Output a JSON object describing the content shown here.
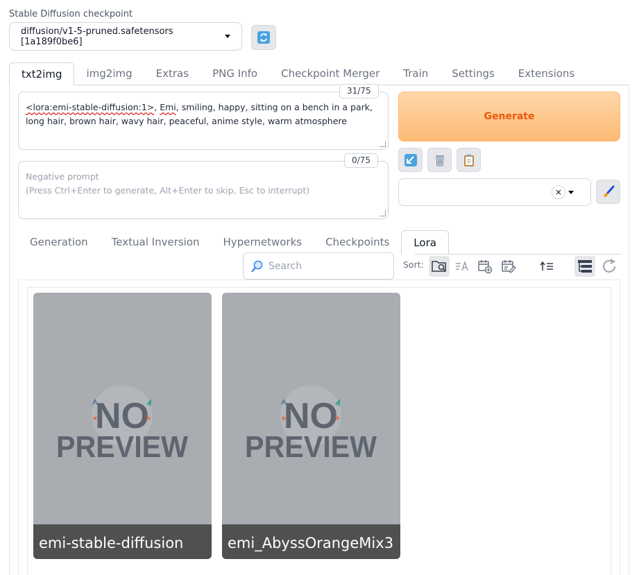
{
  "checkpoint": {
    "label": "Stable Diffusion checkpoint",
    "value": "diffusion/v1-5-pruned.safetensors [1a189f0be6]"
  },
  "main_tabs": [
    {
      "label": "txt2img",
      "active": true
    },
    {
      "label": "img2img"
    },
    {
      "label": "Extras"
    },
    {
      "label": "PNG Info"
    },
    {
      "label": "Checkpoint Merger"
    },
    {
      "label": "Train"
    },
    {
      "label": "Settings"
    },
    {
      "label": "Extensions"
    }
  ],
  "prompt": {
    "counter": "31/75",
    "lora_tag": "<lora:emi-stable-diffusion:1>",
    "sep": ", ",
    "word_emi": "Emi",
    "rest": ", smiling, happy, sitting on a bench in a park, long hair, brown hair, wavy hair, peaceful, anime style, warm atmosphere"
  },
  "negative_prompt": {
    "counter": "0/75",
    "placeholder_line1": "Negative prompt",
    "placeholder_line2": "(Press Ctrl+Enter to generate, Alt+Enter to skip, Esc to interrupt)"
  },
  "generate_label": "Generate",
  "clear_symbol": "×",
  "tool_icons": [
    "read-params-icon",
    "trash-icon",
    "clipboard-icon",
    "paintbrush-icon"
  ],
  "extra_tabs": [
    {
      "label": "Generation"
    },
    {
      "label": "Textual Inversion"
    },
    {
      "label": "Hypernetworks"
    },
    {
      "label": "Checkpoints"
    },
    {
      "label": "Lora",
      "active": true
    }
  ],
  "search": {
    "placeholder": "Search"
  },
  "sort_label": "Sort:",
  "cards": [
    {
      "name": "emi-stable-diffusion",
      "preview_text_1": "NO",
      "preview_text_2": "PREVIEW"
    },
    {
      "name": "emi_AbyssOrangeMix3",
      "preview_text_1": "NO",
      "preview_text_2": "PREVIEW"
    }
  ],
  "colors": {
    "accent": "#ea580c",
    "generate_bg": "#fdba74"
  }
}
